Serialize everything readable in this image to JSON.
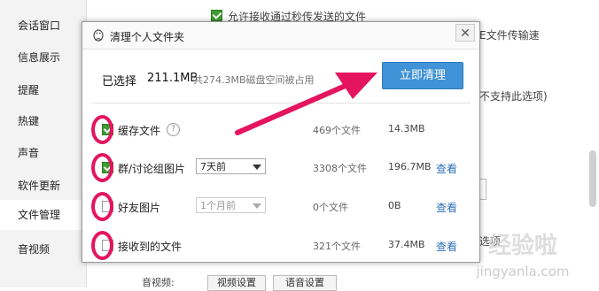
{
  "sidebar": {
    "items": [
      {
        "label": "会话窗口"
      },
      {
        "label": "信息展示"
      },
      {
        "label": "提醒"
      },
      {
        "label": "热键"
      },
      {
        "label": "声音"
      },
      {
        "label": "软件更新"
      },
      {
        "label": "文件管理"
      },
      {
        "label": "音视频"
      }
    ],
    "active_index": 6
  },
  "background": {
    "allow_text": "允许接收通过秒传发送的文件",
    "transfer_text": "E文件传输速",
    "unsupported_text": "不支持此选项)",
    "item_text": "选项",
    "buttons": [
      "音视频:",
      "视频设置",
      "语音设置"
    ]
  },
  "dialog": {
    "title": "清理个人文件夹",
    "close_symbol": "✕",
    "selected_label": "已选择",
    "selected_value": "211.1MB",
    "disk_note": "共274.3MB磁盘空间被占用",
    "clean_button": "立即清理",
    "rows": [
      {
        "checked": true,
        "label": "缓存文件",
        "help": "?",
        "count": "469个文件",
        "size": "14.3MB",
        "view": ""
      },
      {
        "checked": true,
        "label": "群/讨论组图片",
        "dropdown": "7天前",
        "count": "3308个文件",
        "size": "196.7MB",
        "view": "查看"
      },
      {
        "checked": false,
        "label": "好友图片",
        "dropdown": "1个月前",
        "count": "0个文件",
        "size": "0B",
        "view": "查看"
      },
      {
        "checked": false,
        "label": "接收到的文件",
        "count": "321个文件",
        "size": "37.4MB",
        "view": "查看"
      }
    ]
  },
  "watermark": {
    "brand": "经验啦",
    "url": "jingyanla.com"
  },
  "colors": {
    "accent": "#3f93d6",
    "annotation": "#e4145f",
    "check": "#3f9b32",
    "link": "#2d6fb6"
  }
}
